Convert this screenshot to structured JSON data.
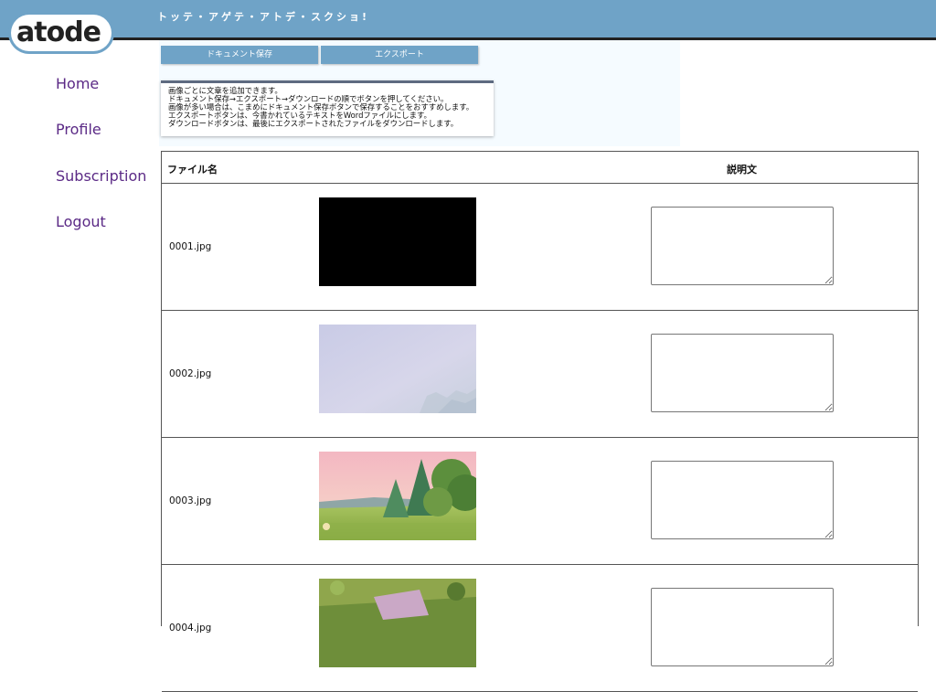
{
  "header": {
    "title": "トッテ・アゲテ・アトデ・スクショ!",
    "logo_text": "atode"
  },
  "sidebar": {
    "items": [
      {
        "label": "Home"
      },
      {
        "label": "Profile"
      },
      {
        "label": "Subscription"
      },
      {
        "label": "Logout"
      }
    ]
  },
  "toolbar": {
    "save_label": "ドキュメント保存",
    "export_label": "エクスポート"
  },
  "info": {
    "lines": [
      "画像ごとに文章を追加できます。",
      "ドキュメント保存→エクスポート→ダウンロードの順でボタンを押してください。",
      "画像が多い場合は、こまめにドキュメント保存ボタンで保存することをおすすめします。",
      "エクスポートボタンは、今書かれているテキストをWordファイルにします。",
      "ダウンロードボタンは、最後にエクスポートされたファイルをダウンロードします。"
    ]
  },
  "table": {
    "headers": {
      "file": "ファイル名",
      "description": "説明文"
    },
    "rows": [
      {
        "file": "0001.jpg",
        "description": ""
      },
      {
        "file": "0002.jpg",
        "description": ""
      },
      {
        "file": "0003.jpg",
        "description": ""
      },
      {
        "file": "0004.jpg",
        "description": ""
      }
    ]
  },
  "colors": {
    "header_bg": "#6fa3c7",
    "nav_link": "#5b2a86",
    "button_bg": "#6fa3c7",
    "info_border": "#5e6a80"
  }
}
